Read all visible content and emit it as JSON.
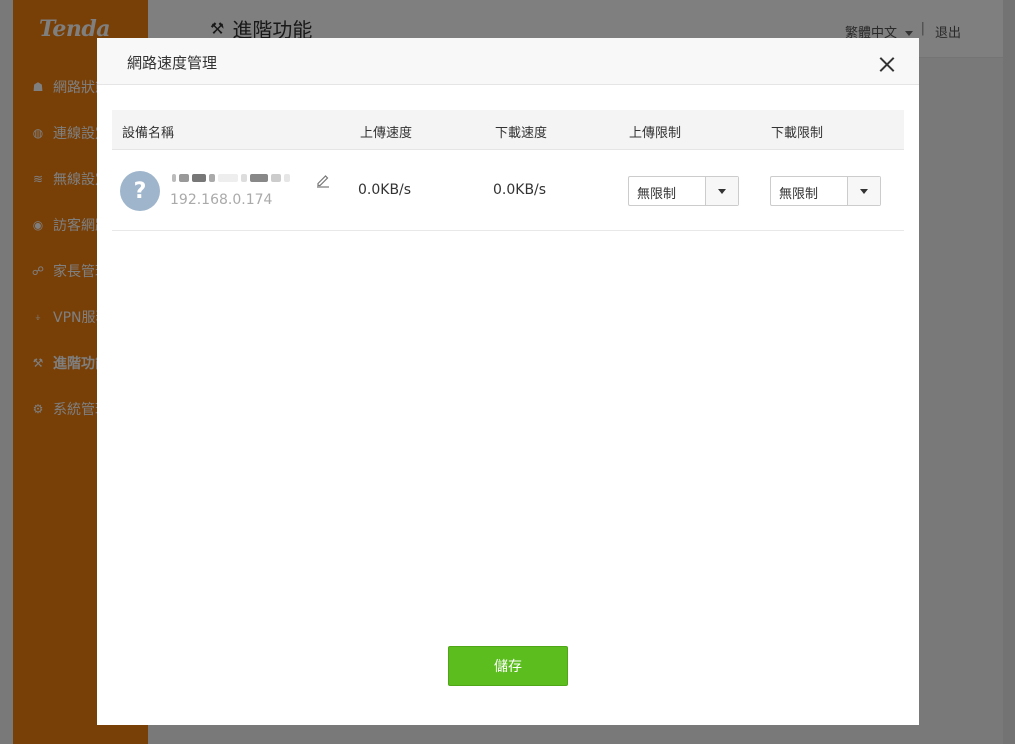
{
  "app": {
    "logo": "Tenda",
    "page_title": "進階功能",
    "language": "繁體中文",
    "separator": "|",
    "logout": "退出"
  },
  "sidebar": {
    "items": [
      {
        "label": "網路狀態",
        "icon": "router-icon"
      },
      {
        "label": "連線設定",
        "icon": "globe-icon"
      },
      {
        "label": "無線設定",
        "icon": "wifi-icon"
      },
      {
        "label": "訪客網路",
        "icon": "guest-icon"
      },
      {
        "label": "家長管理",
        "icon": "family-icon"
      },
      {
        "label": "VPN服務",
        "icon": "vpn-icon"
      },
      {
        "label": "進階功能",
        "icon": "wrench-icon",
        "active": true
      },
      {
        "label": "系統管理",
        "icon": "gear-icon"
      }
    ]
  },
  "modal": {
    "title": "網路速度管理",
    "columns": {
      "device": "設備名稱",
      "upload_speed": "上傳速度",
      "download_speed": "下載速度",
      "upload_limit": "上傳限制",
      "download_limit": "下載限制"
    },
    "rows": [
      {
        "avatar_symbol": "?",
        "ip": "192.168.0.174",
        "upload_speed": "0.0KB/s",
        "download_speed": "0.0KB/s",
        "upload_limit": "無限制",
        "download_limit": "無限制"
      }
    ],
    "save_label": "儲存"
  },
  "colors": {
    "brand_orange": "#f07f0f",
    "save_green": "#5bbd1e",
    "avatar_blue": "#9eb5cc"
  }
}
